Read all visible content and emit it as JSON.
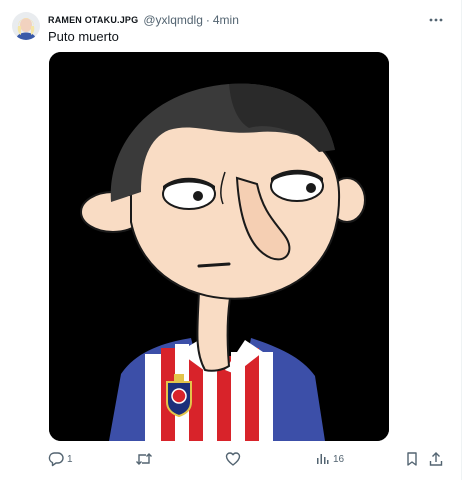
{
  "post": {
    "author_name": "RAMEN OTAKU.JPG",
    "handle": "@yxlqmdlg",
    "separator": "·",
    "time": "4min",
    "text": "Puto muerto"
  },
  "actions": {
    "reply_count": "1",
    "views_count": "16"
  },
  "icons": [
    "avatar",
    "more-icon",
    "reply-icon",
    "repost-icon",
    "like-icon",
    "views-icon",
    "bookmark-icon",
    "share-icon"
  ],
  "colors": {
    "text": "#0f1419",
    "secondary": "#536471",
    "media_background": "#000000"
  }
}
